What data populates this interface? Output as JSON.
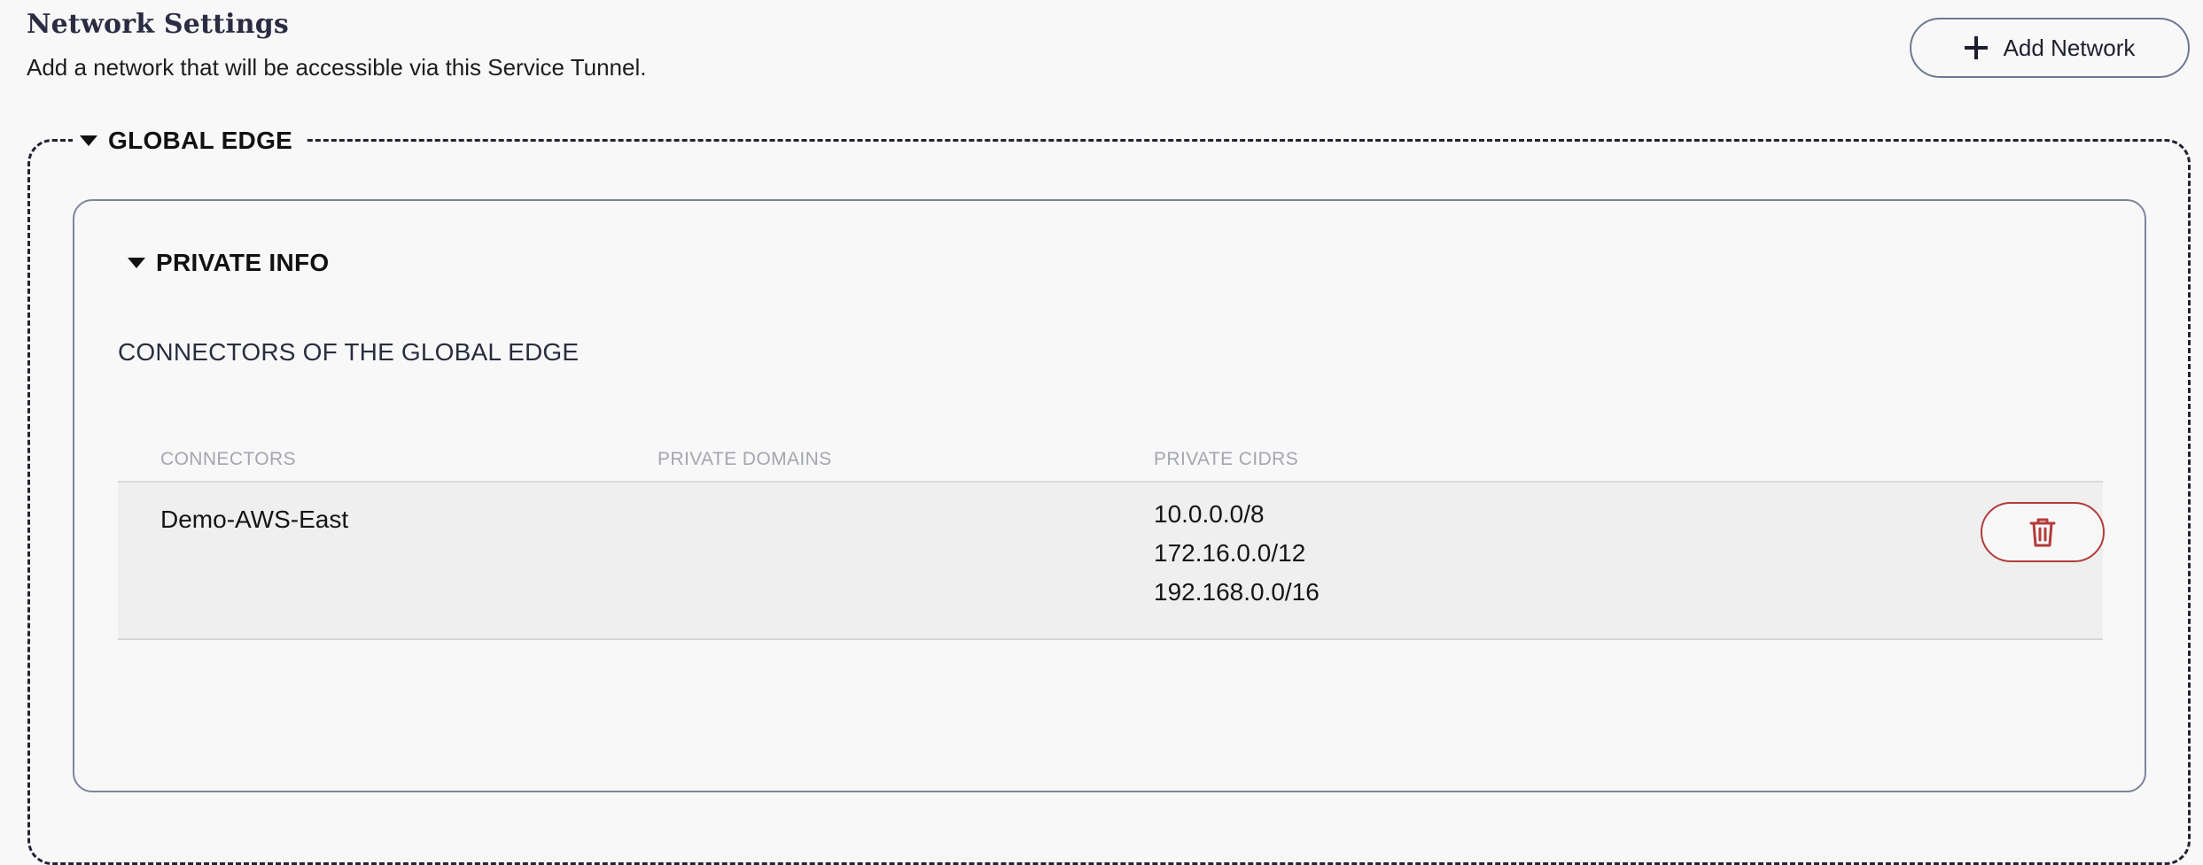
{
  "header": {
    "title": "Network Settings",
    "subtitle": "Add a network that will be accessible via this Service Tunnel.",
    "add_button_label": "Add Network"
  },
  "global_edge": {
    "legend": "GLOBAL EDGE",
    "expanded": true,
    "private_info": {
      "toggle_label": "PRIVATE INFO",
      "expanded": true,
      "heading": "CONNECTORS OF THE GLOBAL EDGE",
      "table": {
        "columns": [
          "CONNECTORS",
          "PRIVATE DOMAINS",
          "PRIVATE CIDRS"
        ],
        "rows": [
          {
            "connector": "Demo-AWS-East",
            "private_domains": "",
            "private_cidrs": [
              "10.0.0.0/8",
              "172.16.0.0/12",
              "192.168.0.0/16"
            ]
          }
        ]
      }
    }
  },
  "icons": {
    "add": "plus-icon",
    "expand": "caret-down-icon",
    "delete": "trash-icon"
  },
  "colors": {
    "background": "#f9f8f9",
    "row_background": "#efefef",
    "danger": "#b33a3a",
    "border": "#7b8599"
  }
}
